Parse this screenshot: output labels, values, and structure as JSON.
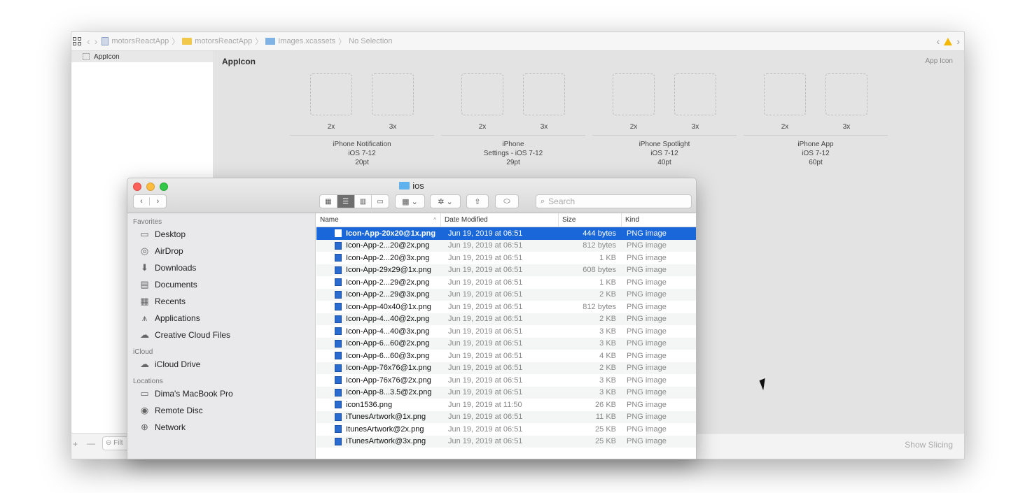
{
  "xcode": {
    "breadcrumbs": [
      "motorsReactApp",
      "motorsReactApp",
      "Images.xcassets",
      "No Selection"
    ],
    "list_item": "AppIcon",
    "editor_title": "AppIcon",
    "editor_type_label": "App Icon",
    "icon_groups": [
      {
        "scale_a": "2x",
        "scale_b": "3x",
        "line1": "iPhone Notification",
        "line2": "iOS 7-12",
        "line3": "20pt"
      },
      {
        "scale_a": "2x",
        "scale_b": "3x",
        "line1": "iPhone",
        "line2": "Settings - iOS 7-12",
        "line3": "29pt"
      },
      {
        "scale_a": "2x",
        "scale_b": "3x",
        "line1": "iPhone Spotlight",
        "line2": "iOS 7-12",
        "line3": "40pt"
      },
      {
        "scale_a": "2x",
        "scale_b": "3x",
        "line1": "iPhone App",
        "line2": "iOS 7-12",
        "line3": "60pt"
      }
    ],
    "bottom": {
      "add": "+",
      "remove": "—",
      "filter_placeholder": "Filt",
      "show_slicing": "Show Slicing"
    }
  },
  "finder": {
    "title": "ios",
    "search_placeholder": "Search",
    "sidebar": {
      "favorites_heading": "Favorites",
      "favorites": [
        {
          "label": "Desktop",
          "icon": "desktop-icon",
          "glyph": "▭"
        },
        {
          "label": "AirDrop",
          "icon": "airdrop-icon",
          "glyph": "◎"
        },
        {
          "label": "Downloads",
          "icon": "downloads-icon",
          "glyph": "⬇"
        },
        {
          "label": "Documents",
          "icon": "documents-icon",
          "glyph": "▤"
        },
        {
          "label": "Recents",
          "icon": "recents-icon",
          "glyph": "▦"
        },
        {
          "label": "Applications",
          "icon": "applications-icon",
          "glyph": "⩚"
        },
        {
          "label": "Creative Cloud Files",
          "icon": "creative-cloud-icon",
          "glyph": "☁"
        }
      ],
      "icloud_heading": "iCloud",
      "icloud": [
        {
          "label": "iCloud Drive",
          "icon": "icloud-drive-icon",
          "glyph": "☁"
        }
      ],
      "locations_heading": "Locations",
      "locations": [
        {
          "label": "Dima's MacBook Pro",
          "icon": "laptop-icon",
          "glyph": "▭"
        },
        {
          "label": "Remote Disc",
          "icon": "disc-icon",
          "glyph": "◉"
        },
        {
          "label": "Network",
          "icon": "network-icon",
          "glyph": "⊕"
        }
      ]
    },
    "columns": {
      "name": "Name",
      "date": "Date Modified",
      "size": "Size",
      "kind": "Kind"
    },
    "files": [
      {
        "name": "Icon-App-20x20@1x.png",
        "date": "Jun 19, 2019 at 06:51",
        "size": "444 bytes",
        "kind": "PNG image",
        "selected": true
      },
      {
        "name": "Icon-App-2...20@2x.png",
        "date": "Jun 19, 2019 at 06:51",
        "size": "812 bytes",
        "kind": "PNG image"
      },
      {
        "name": "Icon-App-2...20@3x.png",
        "date": "Jun 19, 2019 at 06:51",
        "size": "1 KB",
        "kind": "PNG image"
      },
      {
        "name": "Icon-App-29x29@1x.png",
        "date": "Jun 19, 2019 at 06:51",
        "size": "608 bytes",
        "kind": "PNG image"
      },
      {
        "name": "Icon-App-2...29@2x.png",
        "date": "Jun 19, 2019 at 06:51",
        "size": "1 KB",
        "kind": "PNG image"
      },
      {
        "name": "Icon-App-2...29@3x.png",
        "date": "Jun 19, 2019 at 06:51",
        "size": "2 KB",
        "kind": "PNG image"
      },
      {
        "name": "Icon-App-40x40@1x.png",
        "date": "Jun 19, 2019 at 06:51",
        "size": "812 bytes",
        "kind": "PNG image"
      },
      {
        "name": "Icon-App-4...40@2x.png",
        "date": "Jun 19, 2019 at 06:51",
        "size": "2 KB",
        "kind": "PNG image"
      },
      {
        "name": "Icon-App-4...40@3x.png",
        "date": "Jun 19, 2019 at 06:51",
        "size": "3 KB",
        "kind": "PNG image"
      },
      {
        "name": "Icon-App-6...60@2x.png",
        "date": "Jun 19, 2019 at 06:51",
        "size": "3 KB",
        "kind": "PNG image"
      },
      {
        "name": "Icon-App-6...60@3x.png",
        "date": "Jun 19, 2019 at 06:51",
        "size": "4 KB",
        "kind": "PNG image"
      },
      {
        "name": "Icon-App-76x76@1x.png",
        "date": "Jun 19, 2019 at 06:51",
        "size": "2 KB",
        "kind": "PNG image"
      },
      {
        "name": "Icon-App-76x76@2x.png",
        "date": "Jun 19, 2019 at 06:51",
        "size": "3 KB",
        "kind": "PNG image"
      },
      {
        "name": "Icon-App-8...3.5@2x.png",
        "date": "Jun 19, 2019 at 06:51",
        "size": "3 KB",
        "kind": "PNG image"
      },
      {
        "name": "icon1536.png",
        "date": "Jun 19, 2019 at 11:50",
        "size": "26 KB",
        "kind": "PNG image"
      },
      {
        "name": "iTunesArtwork@1x.png",
        "date": "Jun 19, 2019 at 06:51",
        "size": "11 KB",
        "kind": "PNG image"
      },
      {
        "name": "ItunesArtwork@2x.png",
        "date": "Jun 19, 2019 at 06:51",
        "size": "25 KB",
        "kind": "PNG image"
      },
      {
        "name": "iTunesArtwork@3x.png",
        "date": "Jun 19, 2019 at 06:51",
        "size": "25 KB",
        "kind": "PNG image"
      }
    ]
  },
  "colors": {
    "selection": "#1967d8",
    "close": "#fc605b",
    "minimize": "#fdbc40",
    "maximize": "#34c84a",
    "warning": "#f5b800"
  }
}
